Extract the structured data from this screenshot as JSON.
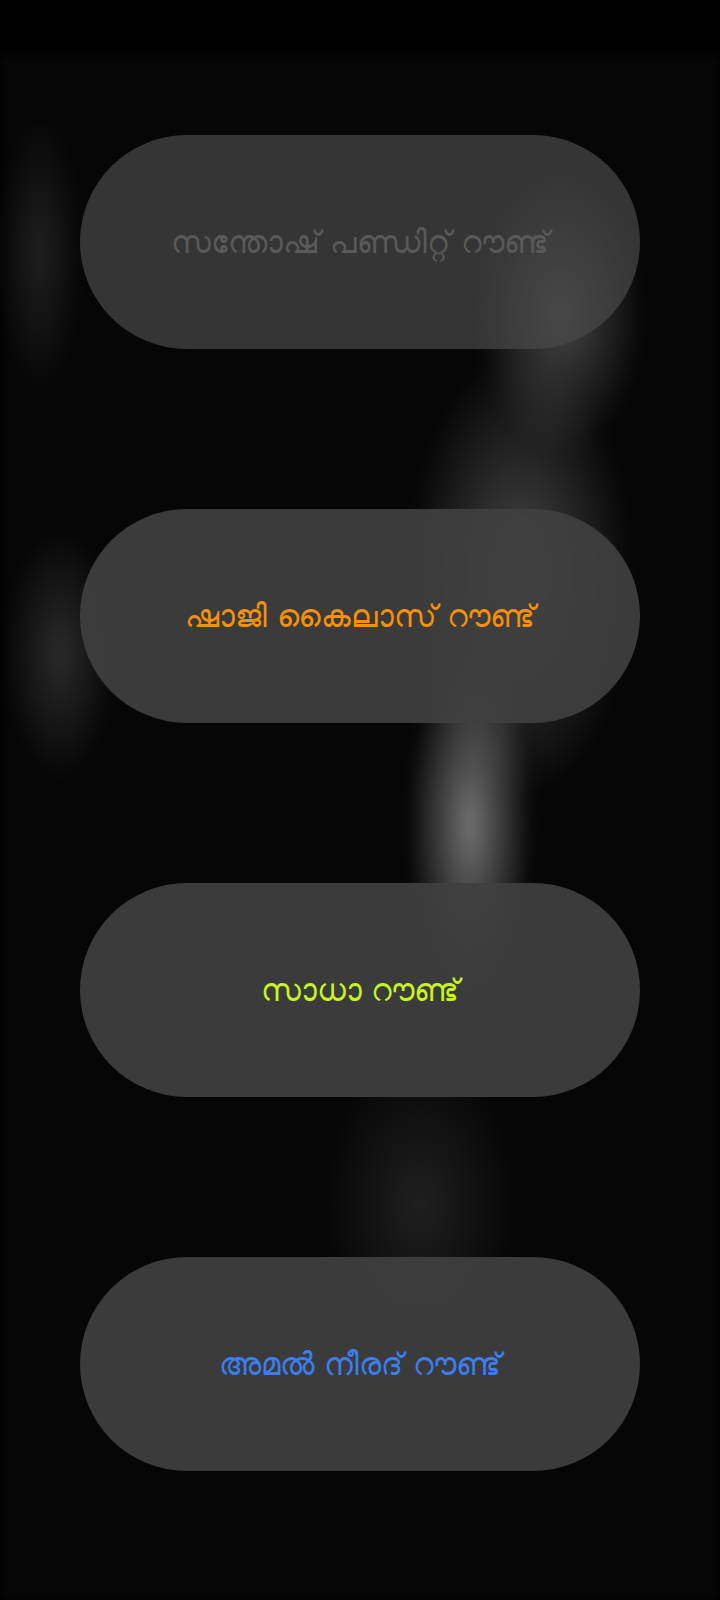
{
  "menu": {
    "buttons": [
      {
        "label": "സന്തോഷ് പണ്ഡിറ്റ് റൗണ്ട്",
        "disabled": true,
        "color": "#5a5a5a"
      },
      {
        "label": "ഷാജി കൈലാസ് റൗണ്ട്",
        "disabled": false,
        "color": "#f5900a"
      },
      {
        "label": "സാധാ റൗണ്ട്",
        "disabled": false,
        "color": "#c8f51e"
      },
      {
        "label": "അമൽ നീരദ് റൗണ്ട്",
        "disabled": false,
        "color": "#3c7ef0"
      }
    ]
  }
}
